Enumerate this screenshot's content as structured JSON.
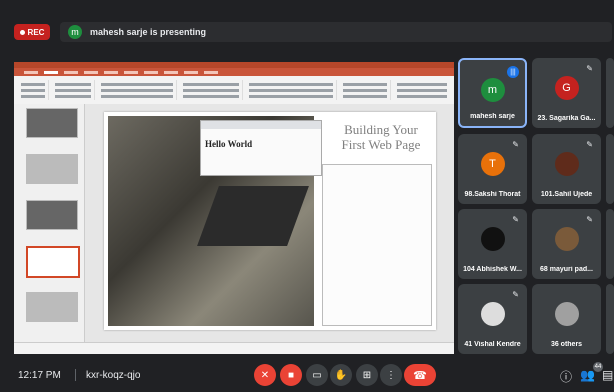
{
  "recording": {
    "label": "REC"
  },
  "presenter_banner": {
    "avatar_letter": "m",
    "text": "mahesh sarje is presenting"
  },
  "slide": {
    "title_line1": "Building Your",
    "title_line2": "First Web Page",
    "browser_heading": "Hello World"
  },
  "participants": [
    {
      "name": "mahesh sarje",
      "initial": "m",
      "color": "#1e8e3e",
      "speaking": true
    },
    {
      "name": "23. Sagarika Ga...",
      "initial": "G",
      "color": "#c5221f",
      "speaking": false
    },
    {
      "name": "98.Sakshi Thorat",
      "initial": "T",
      "color": "#e8710a",
      "speaking": false
    },
    {
      "name": "101.Sahil Ujede",
      "initial": "",
      "color": "#5f2b1b",
      "speaking": false
    },
    {
      "name": "104 Abhishek W...",
      "initial": "",
      "color": "#111111",
      "speaking": false
    },
    {
      "name": "68 mayuri pad...",
      "initial": "",
      "color": "#7a5a3a",
      "speaking": false
    },
    {
      "name": "41 Vishal Kendre",
      "initial": "",
      "color": "#dddddd",
      "speaking": false
    },
    {
      "name": "36 others",
      "initial": "",
      "color": "#a0a0a0",
      "speaking": false
    }
  ],
  "bottom": {
    "time": "12:17 PM",
    "meeting_code": "kxr-koqz-qjo",
    "people_count": "44"
  }
}
